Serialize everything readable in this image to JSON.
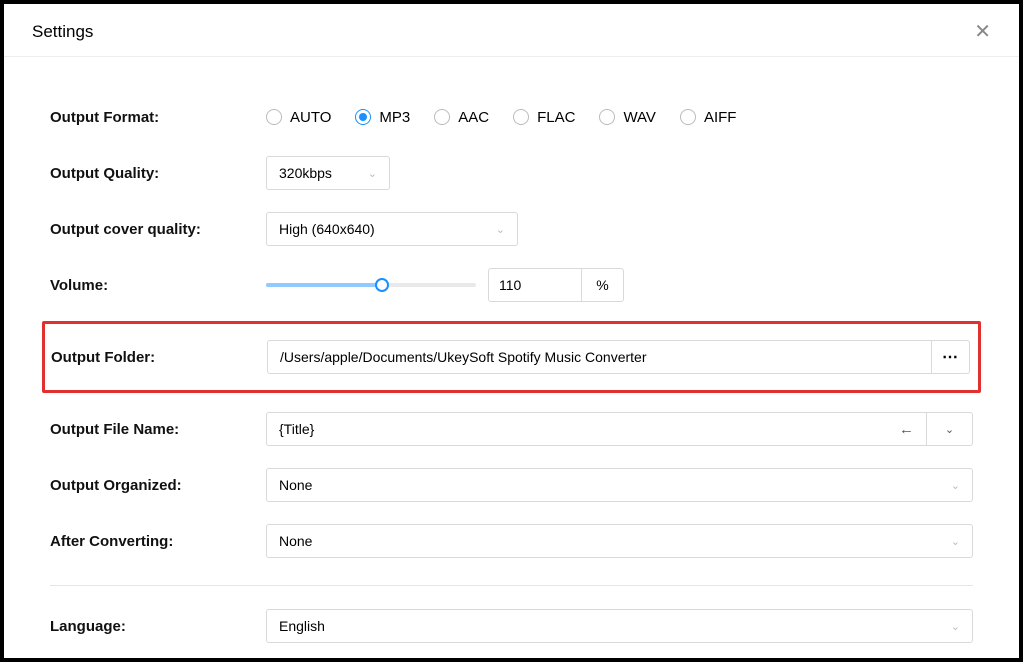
{
  "header": {
    "title": "Settings"
  },
  "labels": {
    "format": "Output Format:",
    "quality": "Output Quality:",
    "coverQuality": "Output cover quality:",
    "volume": "Volume:",
    "folder": "Output Folder:",
    "filename": "Output File Name:",
    "organized": "Output Organized:",
    "after": "After Converting:",
    "language": "Language:"
  },
  "format": {
    "options": [
      "AUTO",
      "MP3",
      "AAC",
      "FLAC",
      "WAV",
      "AIFF"
    ],
    "selected": "MP3"
  },
  "quality": {
    "value": "320kbps"
  },
  "coverQuality": {
    "value": "High (640x640)"
  },
  "volume": {
    "value": "110",
    "unit": "%",
    "percentOfRange": 55
  },
  "folder": {
    "path": "/Users/apple/Documents/UkeySoft Spotify Music Converter"
  },
  "filename": {
    "template": "{Title}"
  },
  "organized": {
    "value": "None"
  },
  "after": {
    "value": "None"
  },
  "language": {
    "value": "English"
  },
  "icons": {
    "browse": "⋯",
    "chevron": "⌄",
    "back": "←",
    "close": "✕"
  }
}
